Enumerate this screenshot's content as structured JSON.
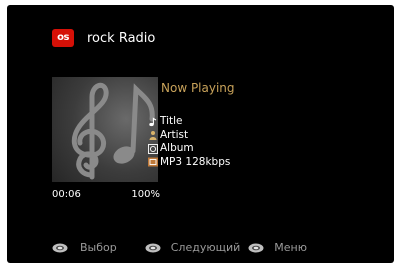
{
  "header": {
    "service_logo_text": "os",
    "service_logo_color": "#d51007",
    "station_title": "rock Radio"
  },
  "cover": {
    "icon": "music-notes-icon"
  },
  "now_playing": {
    "label": "Now Playing",
    "label_color": "#c8a25a"
  },
  "meta": {
    "title": "Title",
    "artist": "Artist",
    "album": "Album",
    "format": "MP3 128kbps",
    "title_icon": "note-icon",
    "artist_icon": "person-icon",
    "album_icon": "disc-icon",
    "format_icon": "format-icon"
  },
  "playback": {
    "elapsed": "00:06",
    "buffer": "100%"
  },
  "footer": {
    "select_label": "Выбор",
    "next_label": "Следующий",
    "menu_label": "Меню",
    "button_icon": "remote-button-icon"
  }
}
